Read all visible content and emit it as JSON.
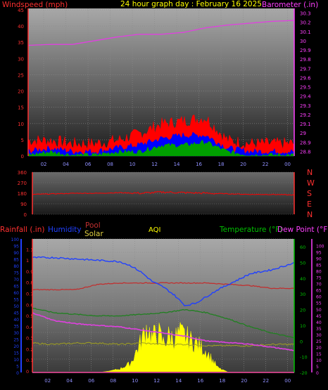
{
  "colors": {
    "wind": "#ff0000",
    "gust": "#ff0000",
    "windAvg": "#0000ff",
    "windLow": "#00a000",
    "barometer": "#e040e0",
    "direction": "#ff0000",
    "humidity": "#2040ff",
    "pool": "#c03030",
    "solar": "#ffff00",
    "temperature": "#208020",
    "dewpoint": "#e040e0",
    "rainfall": "#ff0000",
    "aqi": "#ffff00",
    "axisLeft": "#ff3030",
    "axisRight": "#ff40ff",
    "axisBlueLeft": "#2040ff",
    "axisGreenRight": "#00c000"
  },
  "top": {
    "title": "24 hour graph day : February 16 2025",
    "left_label": "Windspeed (mph)",
    "right_label": "Barometer (.in)"
  },
  "middle": {
    "dir_letters": [
      "N",
      "W",
      "S",
      "E",
      "N"
    ]
  },
  "bottom": {
    "rain_label": "Rainfall (.in)",
    "hum_label": "Humidity",
    "pool_label": "Pool",
    "solar_label": "Solar",
    "aqi_label": "AQI",
    "temp_label": "Temperature (°F)",
    "dew_label": "Dew Point (°F)"
  },
  "chart_data": [
    {
      "type": "area",
      "title": "24 hour graph day : February 16 2025",
      "x_ticks": [
        "02",
        "04",
        "06",
        "08",
        "10",
        "12",
        "14",
        "16",
        "18",
        "20",
        "22",
        "00"
      ],
      "y_left": {
        "label": "Windspeed (mph)",
        "ticks": [
          0,
          5,
          10,
          15,
          20,
          25,
          30,
          35,
          40,
          45
        ],
        "range": [
          0,
          45
        ]
      },
      "y_right": {
        "label": "Barometer (.in)",
        "ticks": [
          "28.8",
          "28.9",
          "29",
          "29.1",
          "29.2",
          "29.3",
          "29.4",
          "29.5",
          "29.6",
          "29.7",
          "29.8",
          "29.9",
          "30",
          "30.1",
          "30.2",
          "30.3"
        ],
        "range": [
          28.75,
          30.35
        ]
      },
      "series": [
        {
          "name": "Barometer (.in)",
          "axis": "right",
          "x": [
            0,
            2,
            4,
            6,
            8,
            10,
            12,
            14,
            16,
            18,
            20,
            22,
            24
          ],
          "y": [
            29.95,
            29.96,
            29.96,
            30.0,
            30.04,
            30.07,
            30.07,
            30.09,
            30.14,
            30.17,
            30.19,
            30.21,
            30.22
          ]
        },
        {
          "axis": "left",
          "x": [
            0,
            2,
            4,
            6,
            8,
            10,
            12,
            14,
            16,
            18,
            20,
            22,
            24
          ],
          "y": [
            4,
            4,
            3,
            3,
            4,
            6,
            9,
            10,
            11,
            4,
            3,
            3,
            3
          ]
        },
        {
          "axis": "left",
          "x": [
            0,
            2,
            4,
            6,
            8,
            10,
            12,
            14,
            16,
            18,
            20,
            22,
            24
          ],
          "y": [
            1,
            2,
            1,
            1,
            2,
            3,
            5,
            6,
            6,
            2,
            1,
            1,
            1
          ]
        },
        {
          "axis": "left",
          "x": [
            0,
            2,
            4,
            6,
            8,
            10,
            12,
            14,
            16,
            18,
            20,
            22,
            24
          ],
          "y": [
            0,
            1,
            0,
            0,
            1,
            1,
            3,
            3,
            4,
            1,
            0,
            0,
            0
          ]
        }
      ]
    },
    {
      "type": "line",
      "y_left": {
        "ticks": [
          0,
          90,
          180,
          270,
          360
        ],
        "range": [
          0,
          360
        ]
      },
      "y_right": {
        "ticks": [
          "N",
          "W",
          "S",
          "E",
          "N"
        ]
      },
      "series": [
        {
          "axis": "left",
          "x": [
            0,
            2,
            4,
            6,
            8,
            10,
            12,
            14,
            16,
            18,
            20,
            22,
            24
          ],
          "y": [
            170,
            175,
            180,
            180,
            185,
            180,
            190,
            185,
            180,
            175,
            170,
            170,
            165
          ]
        }
      ]
    },
    {
      "type": "line",
      "x_ticks": [
        "02",
        "04",
        "06",
        "08",
        "10",
        "12",
        "14",
        "16",
        "18",
        "20",
        "22",
        "00"
      ],
      "y_left_outer": {
        "label": "Rainfall (.in)",
        "ticks": [
          "0",
          "0.1",
          "0.2",
          "0.3",
          "0.4",
          "0.5",
          "0.6",
          "0.7",
          "0.8",
          "0.9",
          "1",
          "1.1"
        ]
      },
      "y_left_inner": {
        "label": "Humidity",
        "ticks": [
          0,
          5,
          10,
          15,
          20,
          25,
          30,
          35,
          40,
          45,
          50,
          55,
          60,
          65,
          70,
          75,
          80,
          85,
          90,
          95,
          100
        ],
        "range": [
          0,
          100
        ]
      },
      "y_right_inner": {
        "label": "Temperature (°F)",
        "ticks": [
          -20,
          -10,
          0,
          10,
          20,
          30,
          40,
          50,
          60
        ],
        "range": [
          -20,
          65
        ]
      },
      "y_right_outer": {
        "label": "Dew Point (°F)",
        "ticks": [
          0,
          5,
          10,
          15,
          20,
          25,
          30,
          35,
          40,
          45,
          50,
          55,
          60,
          65,
          70,
          75,
          80,
          85,
          90,
          95,
          100
        ]
      },
      "series": [
        {
          "name": "Humidity",
          "axis": "humidity",
          "x": [
            0,
            2,
            4,
            6,
            8,
            9,
            10,
            11,
            12,
            13,
            14,
            15,
            16,
            17,
            18,
            20,
            22,
            24
          ],
          "y": [
            86,
            86,
            85,
            84,
            83,
            80,
            75,
            68,
            64,
            58,
            50,
            52,
            57,
            62,
            66,
            74,
            77,
            82
          ]
        },
        {
          "name": "Temperature (°F)",
          "axis": "temp",
          "x": [
            0,
            2,
            4,
            6,
            8,
            10,
            12,
            14,
            16,
            18,
            20,
            22,
            24
          ],
          "y": [
            21,
            18,
            17,
            16,
            16,
            17,
            18,
            20,
            18,
            14,
            9,
            5,
            2
          ]
        },
        {
          "name": "Dew Point (°F)",
          "axis": "temp",
          "x": [
            0,
            2,
            4,
            6,
            8,
            10,
            12,
            14,
            16,
            18,
            20,
            22,
            24
          ],
          "y": [
            18,
            13,
            11,
            10,
            9,
            7,
            5,
            3,
            0,
            -1,
            -2,
            -4,
            -6
          ]
        },
        {
          "name": "Pool",
          "axis": "humidity",
          "x": [
            0,
            4,
            5,
            6,
            8,
            12,
            16,
            18,
            20,
            22,
            24
          ],
          "y": [
            62,
            62,
            64,
            66,
            67,
            67,
            67,
            66,
            65,
            63,
            63
          ]
        },
        {
          "name": "Solar",
          "axis": "humidity",
          "x": [
            0,
            6,
            7,
            8,
            9,
            10,
            10.5,
            11,
            11.5,
            12,
            12.5,
            13,
            13.5,
            14,
            14.5,
            15,
            16,
            17,
            18,
            24
          ],
          "y": [
            0,
            0,
            1,
            3,
            8,
            28,
            40,
            30,
            36,
            26,
            32,
            30,
            34,
            32,
            28,
            26,
            18,
            4,
            0,
            0
          ]
        },
        {
          "name": "Rainfall (.in)",
          "axis": "humidity",
          "x": [
            0,
            24
          ],
          "y": [
            0,
            0
          ]
        },
        {
          "name": "AQI",
          "axis": "humidity",
          "x": [
            0,
            2,
            4,
            6,
            8,
            10,
            12,
            14,
            16,
            18,
            20,
            22,
            24
          ],
          "y": [
            22,
            21,
            22,
            22,
            21,
            22,
            21,
            21,
            20,
            20,
            20,
            21,
            21
          ]
        }
      ]
    }
  ]
}
